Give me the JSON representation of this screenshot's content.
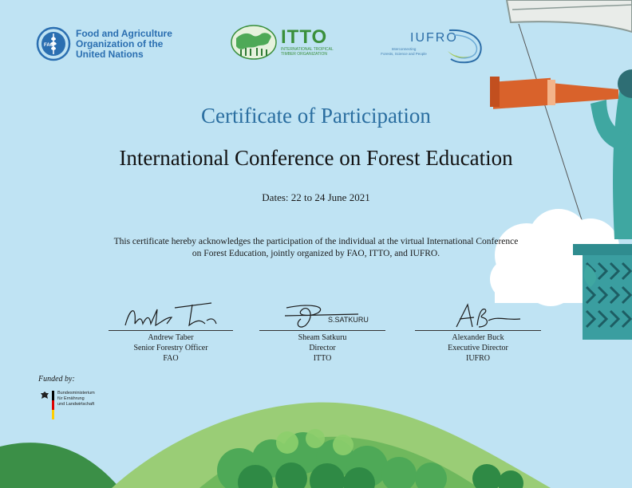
{
  "logos": {
    "fao": {
      "emblem_text": "FAO",
      "emblem_motto": "FIAT PANIS",
      "name_lines": [
        "Food and Agriculture",
        "Organization of the",
        "United Nations"
      ]
    },
    "itto": {
      "emblem_text": "ITTO",
      "name": "ITTO",
      "sub_lines": [
        "INTERNATIONAL TROPICAL",
        "TIMBER ORGANIZATION"
      ]
    },
    "iufro": {
      "name": "IUFRO",
      "sub_lines": [
        "Interconnecting",
        "Forests, Science and People"
      ]
    }
  },
  "certificate": {
    "title": "Certificate of Participation",
    "event": "International Conference on Forest Education",
    "dates": "Dates: 22 to 24 June 2021",
    "acknowledgement_line1": "This certificate hereby acknowledges the participation of the individual at the virtual International Conference",
    "acknowledgement_line2": "on Forest Education, jointly organized by FAO, ITTO, and IUFRO."
  },
  "signatories": [
    {
      "name": "Andrew Taber",
      "title": "Senior Forestry Officer",
      "org": "FAO"
    },
    {
      "name": "Sheam Satkuru",
      "title": "Director",
      "org": "ITTO",
      "signature_text": "S.SATKURU"
    },
    {
      "name": "Alexander Buck",
      "title": "Executive Director",
      "org": "IUFRO"
    }
  ],
  "funding": {
    "label": "Funded by:",
    "ministry_lines": [
      "Bundesministerium",
      "für Ernährung",
      "und Landwirtschaft"
    ]
  },
  "colors": {
    "background": "#bfe3f3",
    "title_blue": "#2a6ea0",
    "fao_blue": "#2b6fb1",
    "itto_green": "#3a8f3b",
    "iufro_blue": "#2c6ea8",
    "hill_green": "#3f9a4a",
    "telescope_orange": "#d9622b",
    "basket_teal": "#2f8c8f"
  }
}
